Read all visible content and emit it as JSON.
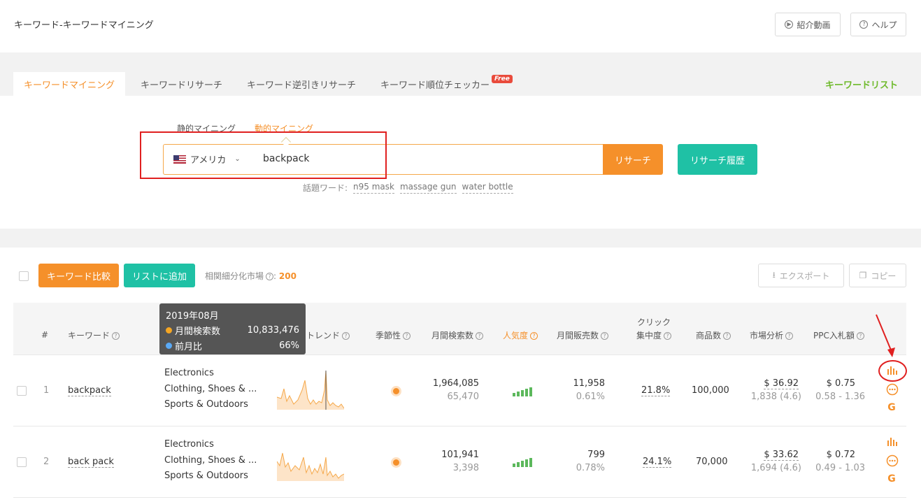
{
  "header": {
    "title": "キーワード-キーワードマイニング",
    "intro_video": "紹介動画",
    "help": "ヘルプ"
  },
  "tabs": [
    {
      "label": "キーワードマイニング"
    },
    {
      "label": "キーワードリサーチ"
    },
    {
      "label": "キーワード逆引きリサーチ"
    },
    {
      "label": "キーワード順位チェッカー"
    }
  ],
  "free_badge": "Free",
  "keyword_list": "キーワードリスト",
  "search": {
    "subtabs": [
      "静的マイニング",
      "動的マイニング"
    ],
    "country": "アメリカ",
    "query": "backpack",
    "research_button": "リサーチ",
    "history_button": "リサーチ履歴",
    "trending_label": "話題ワード:",
    "trending": [
      "n95 mask",
      "massage gun",
      "water bottle"
    ]
  },
  "toolbar": {
    "compare": "キーワード比較",
    "add_to_list": "リストに追加",
    "market_label": "相関細分化市場",
    "market_count": "200",
    "export": "エクスポート",
    "copy": "コピー"
  },
  "table": {
    "headers": {
      "num": "#",
      "keyword": "キーワード",
      "trend": "トレンド",
      "seasonality": "季節性",
      "monthly_search": "月間検索数",
      "popularity": "人気度",
      "monthly_sales": "月間販売数",
      "click_concentration_1": "クリック",
      "click_concentration_2": "集中度",
      "products": "商品数",
      "market_analysis": "市場分析",
      "ppc": "PPC入札額"
    },
    "tooltip": {
      "month": "2019年08月",
      "search_label": "月間検索数",
      "search_value": "10,833,476",
      "mom_label": "前月比",
      "mom_value": "66%"
    },
    "rows": [
      {
        "num": "1",
        "keyword": "backpack",
        "categories": [
          "Electronics",
          "Clothing, Shoes & ...",
          "Sports & Outdoors"
        ],
        "monthly_search": "1,964,085",
        "monthly_search_sub": "65,470",
        "monthly_sales": "11,958",
        "sales_rate": "0.61%",
        "click_concentration": "21.8%",
        "products": "100,000",
        "market_price": "$ 36.92",
        "market_reviews": "1,838 (4.6)",
        "ppc": "$ 0.75",
        "ppc_range": "0.58 - 1.36"
      },
      {
        "num": "2",
        "keyword": "back pack",
        "categories": [
          "Electronics",
          "Clothing, Shoes & ...",
          "Sports & Outdoors"
        ],
        "monthly_search": "101,941",
        "monthly_search_sub": "3,398",
        "monthly_sales": "799",
        "sales_rate": "0.78%",
        "click_concentration": "24.1%",
        "products": "70,000",
        "market_price": "$ 33.62",
        "market_reviews": "1,694 (4.6)",
        "ppc": "$ 0.72",
        "ppc_range": "0.49 - 1.03"
      }
    ]
  },
  "colors": {
    "accent_orange": "#f5902a",
    "accent_teal": "#1fc1a5",
    "accent_green": "#6fba2c",
    "highlight_red": "#e02020"
  }
}
